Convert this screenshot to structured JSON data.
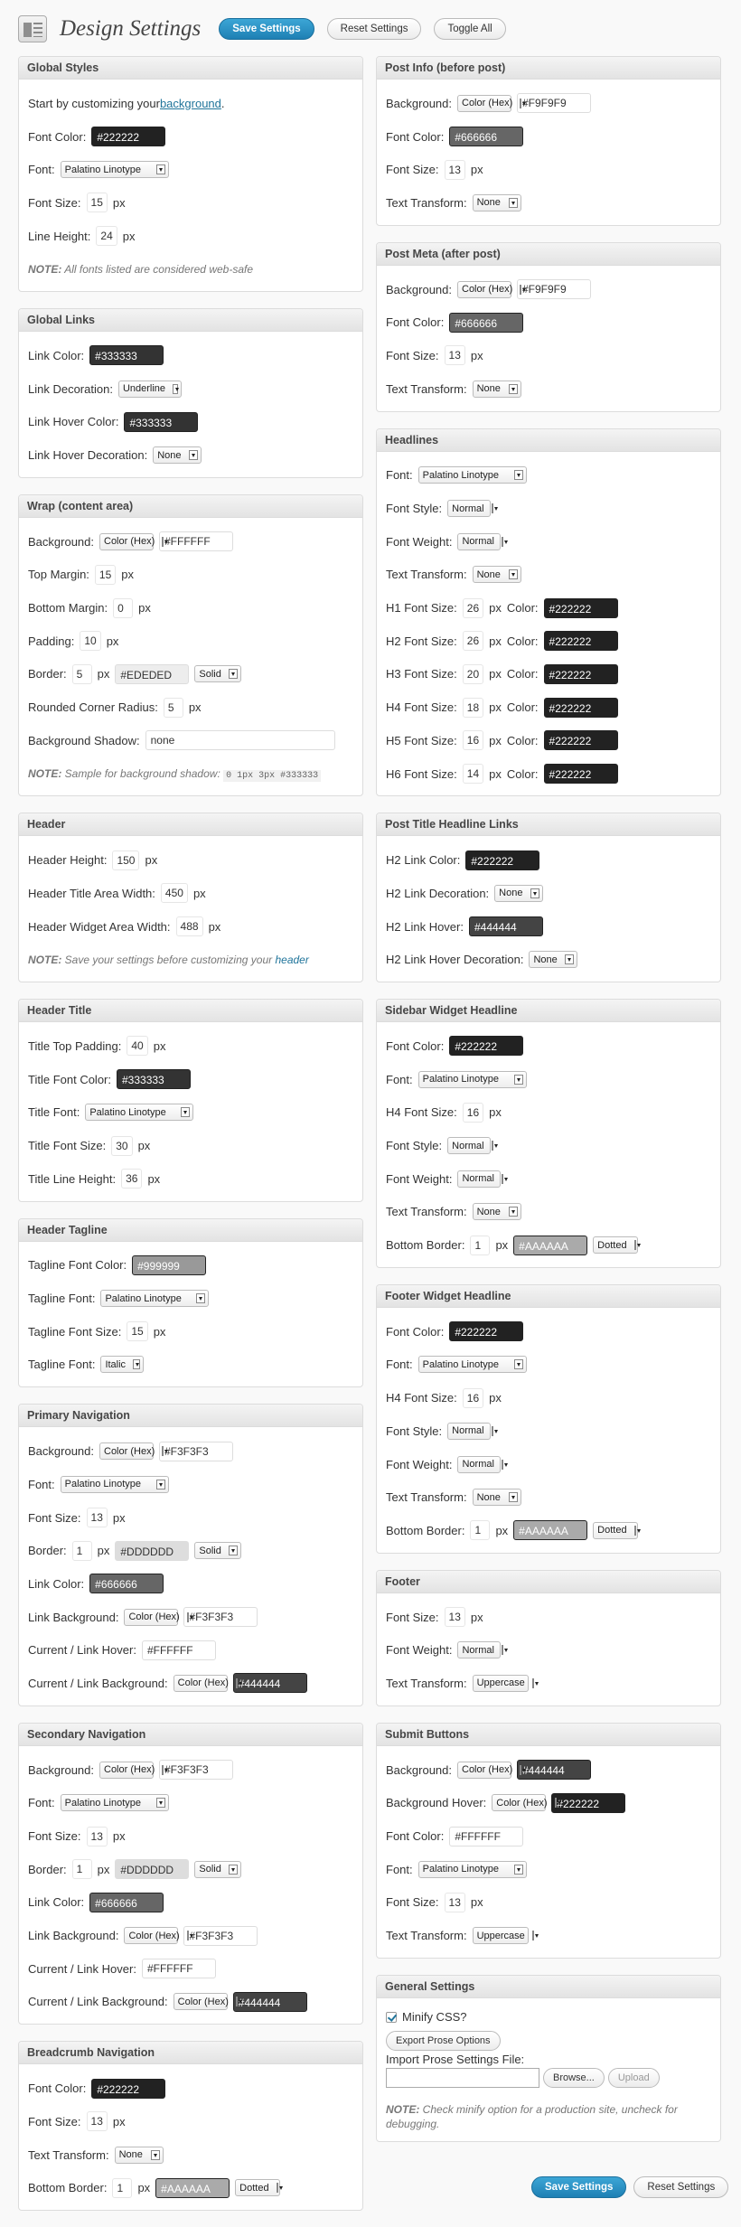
{
  "title": "Design Settings",
  "buttons": {
    "save": "Save Settings",
    "reset": "Reset Settings",
    "toggle": "Toggle All"
  },
  "colors": {
    "accent": "#21759b"
  },
  "left": [
    {
      "title": "Global Styles",
      "rows": [
        {
          "type": "intro",
          "text": "Start by customizing your ",
          "link": "background",
          "after": "."
        },
        {
          "label": "Font Color:",
          "color": "#222222"
        },
        {
          "label": "Font:",
          "select": "Palatino Linotype"
        },
        {
          "label": "Font Size:",
          "num": "15",
          "unit": "px"
        },
        {
          "label": "Line Height:",
          "num": "24",
          "unit": "px"
        },
        {
          "type": "note",
          "bold": "NOTE:",
          "text": " All fonts listed are considered web-safe"
        }
      ]
    },
    {
      "title": "Global Links",
      "rows": [
        {
          "label": "Link Color:",
          "color": "#333333"
        },
        {
          "label": "Link Decoration:",
          "select": "Underline"
        },
        {
          "label": "Link Hover Color:",
          "color": "#333333"
        },
        {
          "label": "Link Hover Decoration:",
          "select": "None"
        }
      ]
    },
    {
      "title": "Wrap (content area)",
      "rows": [
        {
          "label": "Background:",
          "select": "Color (Hex)",
          "text": "#FFFFFF"
        },
        {
          "label": "Top Margin:",
          "num": "15",
          "unit": "px"
        },
        {
          "label": "Bottom Margin:",
          "num": "0",
          "unit": "px"
        },
        {
          "label": "Padding:",
          "num": "10",
          "unit": "px"
        },
        {
          "label": "Border:",
          "num": "5",
          "unit": "px",
          "color": "#EDEDED",
          "select2": "Solid"
        },
        {
          "label": "Rounded Corner Radius:",
          "num": "5",
          "unit": "px"
        },
        {
          "label": "Background Shadow:",
          "text": "none",
          "wide": true
        },
        {
          "type": "note",
          "bold": "NOTE:",
          "text": " Sample for background shadow: ",
          "code": "0 1px 3px #333333"
        }
      ]
    },
    {
      "title": "Header",
      "rows": [
        {
          "label": "Header Height:",
          "num": "150",
          "unit": "px"
        },
        {
          "label": "Header Title Area Width:",
          "num": "450",
          "unit": "px"
        },
        {
          "label": "Header Widget Area Width:",
          "num": "488",
          "unit": "px"
        },
        {
          "type": "note",
          "bold": "NOTE:",
          "text": " Save your settings before customizing your ",
          "link": "header"
        }
      ]
    },
    {
      "title": "Header Title",
      "rows": [
        {
          "label": "Title Top Padding:",
          "num": "40",
          "unit": "px"
        },
        {
          "label": "Title Font Color:",
          "color": "#333333"
        },
        {
          "label": "Title Font:",
          "select": "Palatino Linotype"
        },
        {
          "label": "Title Font Size:",
          "num": "30",
          "unit": "px"
        },
        {
          "label": "Title Line Height:",
          "num": "36",
          "unit": "px"
        }
      ]
    },
    {
      "title": "Header Tagline",
      "rows": [
        {
          "label": "Tagline Font Color:",
          "color": "#999999"
        },
        {
          "label": "Tagline Font:",
          "select": "Palatino Linotype"
        },
        {
          "label": "Tagline Font Size:",
          "num": "15",
          "unit": "px"
        },
        {
          "label": "Tagline Font:",
          "select": "Italic"
        }
      ]
    },
    {
      "title": "Primary Navigation",
      "rows": [
        {
          "label": "Background:",
          "select": "Color (Hex)",
          "text": "#F3F3F3"
        },
        {
          "label": "Font:",
          "select": "Palatino Linotype"
        },
        {
          "label": "Font Size:",
          "num": "13",
          "unit": "px"
        },
        {
          "label": "Border:",
          "num": "1",
          "unit": "px",
          "color": "#DDDDDD",
          "select2": "Solid"
        },
        {
          "label": "Link Color:",
          "color": "#666666"
        },
        {
          "label": "Link Background:",
          "select": "Color (Hex)",
          "text": "#F3F3F3"
        },
        {
          "label": "Current / Link Hover:",
          "text": "#FFFFFF"
        },
        {
          "label": "Current / Link Background:",
          "select": "Color (Hex)",
          "color": "#444444"
        }
      ]
    },
    {
      "title": "Secondary Navigation",
      "rows": [
        {
          "label": "Background:",
          "select": "Color (Hex)",
          "text": "#F3F3F3"
        },
        {
          "label": "Font:",
          "select": "Palatino Linotype"
        },
        {
          "label": "Font Size:",
          "num": "13",
          "unit": "px"
        },
        {
          "label": "Border:",
          "num": "1",
          "unit": "px",
          "color": "#DDDDDD",
          "select2": "Solid"
        },
        {
          "label": "Link Color:",
          "color": "#666666"
        },
        {
          "label": "Link Background:",
          "select": "Color (Hex)",
          "text": "#F3F3F3"
        },
        {
          "label": "Current / Link Hover:",
          "text": "#FFFFFF"
        },
        {
          "label": "Current / Link Background:",
          "select": "Color (Hex)",
          "color": "#444444"
        }
      ]
    },
    {
      "title": "Breadcrumb Navigation",
      "rows": [
        {
          "label": "Font Color:",
          "color": "#222222"
        },
        {
          "label": "Font Size:",
          "num": "13",
          "unit": "px"
        },
        {
          "label": "Text Transform:",
          "select": "None"
        },
        {
          "label": "Bottom Border:",
          "num": "1",
          "unit": "px",
          "color": "#AAAAAA",
          "select2": "Dotted"
        }
      ]
    }
  ],
  "right": [
    {
      "title": "Post Info (before post)",
      "rows": [
        {
          "label": "Background:",
          "select": "Color (Hex)",
          "text": "#F9F9F9"
        },
        {
          "label": "Font Color:",
          "color": "#666666"
        },
        {
          "label": "Font Size:",
          "num": "13",
          "unit": "px"
        },
        {
          "label": "Text Transform:",
          "select": "None"
        }
      ]
    },
    {
      "title": "Post Meta (after post)",
      "rows": [
        {
          "label": "Background:",
          "select": "Color (Hex)",
          "text": "#F9F9F9"
        },
        {
          "label": "Font Color:",
          "color": "#666666"
        },
        {
          "label": "Font Size:",
          "num": "13",
          "unit": "px"
        },
        {
          "label": "Text Transform:",
          "select": "None"
        }
      ]
    },
    {
      "title": "Headlines",
      "rows": [
        {
          "label": "Font:",
          "select": "Palatino Linotype"
        },
        {
          "label": "Font Style:",
          "select": "Normal"
        },
        {
          "label": "Font Weight:",
          "select": "Normal"
        },
        {
          "label": "Text Transform:",
          "select": "None"
        },
        {
          "label": "H1 Font Size:",
          "num": "26",
          "unit": "px",
          "label2": "Color:",
          "color": "#222222"
        },
        {
          "label": "H2 Font Size:",
          "num": "26",
          "unit": "px",
          "label2": "Color:",
          "color": "#222222"
        },
        {
          "label": "H3 Font Size:",
          "num": "20",
          "unit": "px",
          "label2": "Color:",
          "color": "#222222"
        },
        {
          "label": "H4 Font Size:",
          "num": "18",
          "unit": "px",
          "label2": "Color:",
          "color": "#222222"
        },
        {
          "label": "H5 Font Size:",
          "num": "16",
          "unit": "px",
          "label2": "Color:",
          "color": "#222222"
        },
        {
          "label": "H6 Font Size:",
          "num": "14",
          "unit": "px",
          "label2": "Color:",
          "color": "#222222"
        }
      ]
    },
    {
      "title": "Post Title Headline Links",
      "rows": [
        {
          "label": "H2 Link Color:",
          "color": "#222222"
        },
        {
          "label": "H2 Link Decoration:",
          "select": "None"
        },
        {
          "label": "H2 Link Hover:",
          "color": "#444444"
        },
        {
          "label": "H2 Link Hover Decoration:",
          "select": "None"
        }
      ]
    },
    {
      "title": "Sidebar Widget Headline",
      "rows": [
        {
          "label": "Font Color:",
          "color": "#222222"
        },
        {
          "label": "Font:",
          "select": "Palatino Linotype"
        },
        {
          "label": "H4 Font Size:",
          "num": "16",
          "unit": "px"
        },
        {
          "label": "Font Style:",
          "select": "Normal"
        },
        {
          "label": "Font Weight:",
          "select": "Normal"
        },
        {
          "label": "Text Transform:",
          "select": "None"
        },
        {
          "label": "Bottom Border:",
          "num": "1",
          "unit": "px",
          "color": "#AAAAAA",
          "select2": "Dotted"
        }
      ]
    },
    {
      "title": "Footer Widget Headline",
      "rows": [
        {
          "label": "Font Color:",
          "color": "#222222"
        },
        {
          "label": "Font:",
          "select": "Palatino Linotype"
        },
        {
          "label": "H4 Font Size:",
          "num": "16",
          "unit": "px"
        },
        {
          "label": "Font Style:",
          "select": "Normal"
        },
        {
          "label": "Font Weight:",
          "select": "Normal"
        },
        {
          "label": "Text Transform:",
          "select": "None"
        },
        {
          "label": "Bottom Border:",
          "num": "1",
          "unit": "px",
          "color": "#AAAAAA",
          "select2": "Dotted"
        }
      ]
    },
    {
      "title": "Footer",
      "rows": [
        {
          "label": "Font Size:",
          "num": "13",
          "unit": "px"
        },
        {
          "label": "Font Weight:",
          "select": "Normal"
        },
        {
          "label": "Text Transform:",
          "select": "Uppercase"
        }
      ]
    },
    {
      "title": "Submit Buttons",
      "rows": [
        {
          "label": "Background:",
          "select": "Color (Hex)",
          "color": "#444444"
        },
        {
          "label": "Background Hover:",
          "select": "Color (Hex)",
          "color": "#222222"
        },
        {
          "label": "Font Color:",
          "text": "#FFFFFF"
        },
        {
          "label": "Font:",
          "select": "Palatino Linotype"
        },
        {
          "label": "Font Size:",
          "num": "13",
          "unit": "px"
        },
        {
          "label": "Text Transform:",
          "select": "Uppercase"
        }
      ]
    },
    {
      "title": "General Settings",
      "rows": [
        {
          "type": "check",
          "label": "Minify CSS?",
          "checked": true
        },
        {
          "type": "button",
          "label": "Export Prose Options"
        },
        {
          "type": "import",
          "label": "Import Prose Settings File:",
          "browse": "Browse...",
          "upload": "Upload"
        },
        {
          "type": "note",
          "bold": "NOTE:",
          "text": " Check minify option for a production site, uncheck for debugging."
        }
      ]
    }
  ]
}
